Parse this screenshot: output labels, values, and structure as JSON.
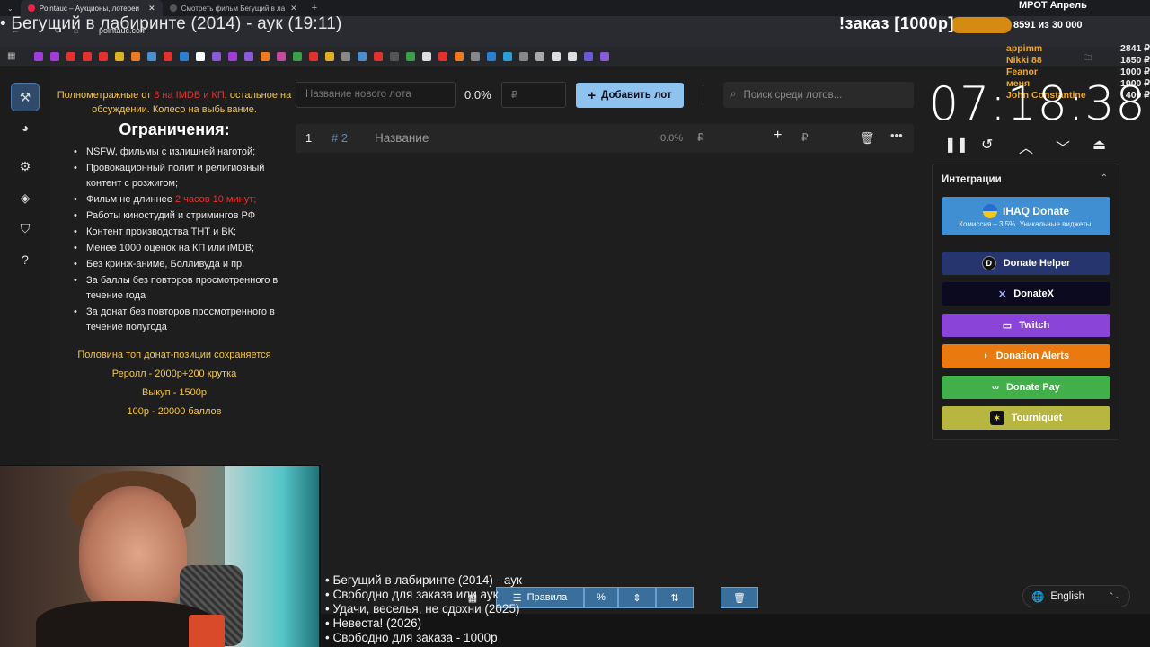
{
  "browser": {
    "tabs": [
      {
        "label": "Pointauc – Аукционы, лотереи"
      },
      {
        "label": "Смотреть фильм Бегущий в ла"
      }
    ],
    "url": "pointauc.com"
  },
  "overlay": {
    "stream_title": "• Бегущий в лабиринте (2014) - аук (19:11)",
    "order_label": "!заказ [1000р]",
    "mrot_title": "МРОТ Апрель",
    "mrot_value": "8591  из 30 000",
    "donors": [
      {
        "name": "appimm",
        "amount": "2841 ₽"
      },
      {
        "name": "Nikki 88",
        "amount": "1850 ₽"
      },
      {
        "name": "Feanor",
        "amount": "1000 ₽"
      },
      {
        "name": "меня",
        "amount": "1000 ₽"
      },
      {
        "name": "John Constantine",
        "amount": "400 ₽"
      }
    ]
  },
  "rules": {
    "top_pre": "Полнометражные от ",
    "top_red": "8 на IMDB и КП",
    "top_post": ", остальное на обсуждении. Колесо на выбывание.",
    "heading": "Ограничения:",
    "items": [
      {
        "text": "NSFW, фильмы с излишней наготой;"
      },
      {
        "text": "Провокационный полит и религиозный контент с розжигом;"
      },
      {
        "pre": "Фильм не длиннее ",
        "red": "2 часов 10 минут;"
      },
      {
        "text": "Работы киностудий и стримингов РФ"
      },
      {
        "text": "Контент производства ТНТ и ВК;"
      },
      {
        "text": "Менее 1000 оценок на КП или iMDB;"
      },
      {
        "text": "Без кринж-аниме, Болливуда и пр."
      },
      {
        "text": "За баллы без повторов просмотренного в течение года"
      },
      {
        "text": "За донат без повторов просмотренного в течение полугода"
      }
    ],
    "footer": [
      "Половина топ донат-позиции сохраняется",
      "Реролл - 2000р+200 крутка",
      "Выкуп - 1500р",
      "100р - 20000 баллов"
    ]
  },
  "lot_form": {
    "name_placeholder": "Название нового лота",
    "percent": "0.0%",
    "amount_placeholder": "₽",
    "add_label": "Добавить лот",
    "search_placeholder": "Поиск среди лотов..."
  },
  "lots": [
    {
      "index": "1",
      "id": "# 2",
      "name": "Название",
      "percent": "0.0%",
      "currency": "₽"
    }
  ],
  "timer": {
    "value": "07:18:38"
  },
  "integrations": {
    "title": "Интеграции",
    "ihaq": {
      "label": "IHAQ Donate",
      "sub": "Комиссия – 3,5%. Уникальные виджеты!"
    },
    "buttons": [
      {
        "label": "Donate Helper",
        "color": "#26356e"
      },
      {
        "label": "DonateX",
        "color": "#0c0a1e"
      },
      {
        "label": "Twitch",
        "color": "#8a44d8"
      },
      {
        "label": "Donation Alerts",
        "color": "#ea7a10"
      },
      {
        "label": "Donate Pay",
        "color": "#42b04a"
      },
      {
        "label": "Tourniquet",
        "color": "#b7b640"
      }
    ]
  },
  "ticker": [
    "• Бегущий в лабиринте (2014) - аук",
    "• Свободно для заказа или аук",
    "• Удачи, веселья, не сдохни (2025)",
    "• Невеста! (2026)",
    "• Свободно для заказа - 1000р"
  ],
  "bottom_toolbar": {
    "rules_label": "Правила"
  },
  "language": {
    "label": "English"
  }
}
